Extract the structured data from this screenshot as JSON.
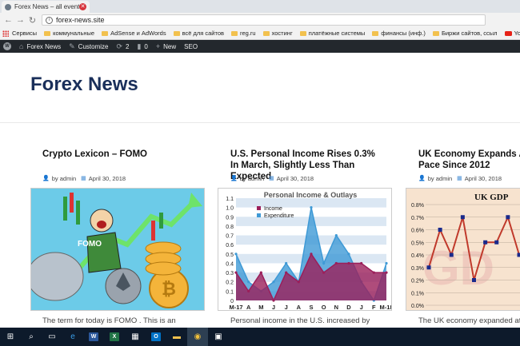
{
  "browser": {
    "tab_title": "Forex News – all events",
    "address": "forex-news.site",
    "bookmarks": [
      {
        "label": "Сервисы",
        "type": "apps"
      },
      {
        "label": "коммунальные",
        "type": "folder"
      },
      {
        "label": "AdSense и AdWords",
        "type": "folder"
      },
      {
        "label": "всё для сайтов",
        "type": "folder"
      },
      {
        "label": "reg.ru",
        "type": "folder"
      },
      {
        "label": "хостинг",
        "type": "folder"
      },
      {
        "label": "платёжные системы",
        "type": "folder"
      },
      {
        "label": "финансы (инф.)",
        "type": "folder"
      },
      {
        "label": "Биржи сайтов, ссыл",
        "type": "folder"
      },
      {
        "label": "YouTube",
        "type": "youtube"
      }
    ]
  },
  "adminbar": {
    "site": "Forex News",
    "customize": "Customize",
    "updates": "2",
    "comments": "0",
    "new": "New",
    "seo": "SEO"
  },
  "site": {
    "title": "Forex News"
  },
  "posts": [
    {
      "title": "Crypto Lexicon – FOMO",
      "author": "by admin",
      "date": "April 30, 2018",
      "excerpt": "The term for today is FOMO . This is an",
      "image_text": "FOMO"
    },
    {
      "title": "U.S. Personal Income Rises 0.3% In March, Slightly Less Than Expected",
      "author": "by admin",
      "date": "April 30, 2018",
      "excerpt": "Personal income in the U.S. increased by"
    },
    {
      "title": "UK Economy Expands At S... Pace Since 2012",
      "title_line1": "UK Economy Expands At S",
      "title_line2": "Pace Since 2012",
      "author": "by admin",
      "date": "April 30, 2018",
      "excerpt": "The UK economy expanded at"
    }
  ],
  "chart_data": [
    {
      "type": "area",
      "title": "Personal Income & Outlays",
      "categories": [
        "M-17",
        "A",
        "M",
        "J",
        "J",
        "A",
        "S",
        "O",
        "N",
        "D",
        "J",
        "F",
        "M-18"
      ],
      "ylim": [
        0,
        1.1
      ],
      "yticks": [
        "0",
        "0.1",
        "0.2",
        "0.3",
        "0.4",
        "0.5",
        "0.6",
        "0.7",
        "0.8",
        "0.9",
        "1.0",
        "1.1"
      ],
      "series": [
        {
          "name": "Income",
          "color": "#9b1f5a",
          "values": [
            0.3,
            0.1,
            0.3,
            0.0,
            0.3,
            0.2,
            0.5,
            0.3,
            0.4,
            0.4,
            0.4,
            0.3,
            0.3
          ]
        },
        {
          "name": "Expenditure",
          "color": "#3f9ad6",
          "values": [
            0.5,
            0.2,
            0.1,
            0.2,
            0.4,
            0.2,
            1.0,
            0.4,
            0.7,
            0.5,
            0.2,
            0.0,
            0.4
          ]
        }
      ]
    },
    {
      "type": "line",
      "title": "UK GDP",
      "ylim": [
        0,
        0.8
      ],
      "yticks": [
        "0.0%",
        "0.1%",
        "0.2%",
        "0.3%",
        "0.4%",
        "0.5%",
        "0.6%",
        "0.7%",
        "0.8%"
      ],
      "series": [
        {
          "name": "",
          "color": "#1a2a8c",
          "values": [
            0.3,
            0.6,
            0.4,
            0.7,
            0.2,
            0.5,
            0.5,
            0.7,
            0.4
          ]
        }
      ]
    }
  ],
  "taskbar": {
    "items": [
      {
        "icon": "windows-start-icon"
      },
      {
        "icon": "search-icon"
      },
      {
        "icon": "task-view-icon"
      },
      {
        "icon": "edge-icon"
      },
      {
        "icon": "word-icon",
        "letter": "W",
        "color": "#2b579a"
      },
      {
        "icon": "excel-icon",
        "letter": "X",
        "color": "#217346"
      },
      {
        "icon": "store-icon"
      },
      {
        "icon": "outlook-icon",
        "letter": "O",
        "color": "#0072c6"
      },
      {
        "icon": "explorer-icon"
      },
      {
        "icon": "chrome-icon"
      },
      {
        "icon": "app-icon"
      }
    ]
  }
}
